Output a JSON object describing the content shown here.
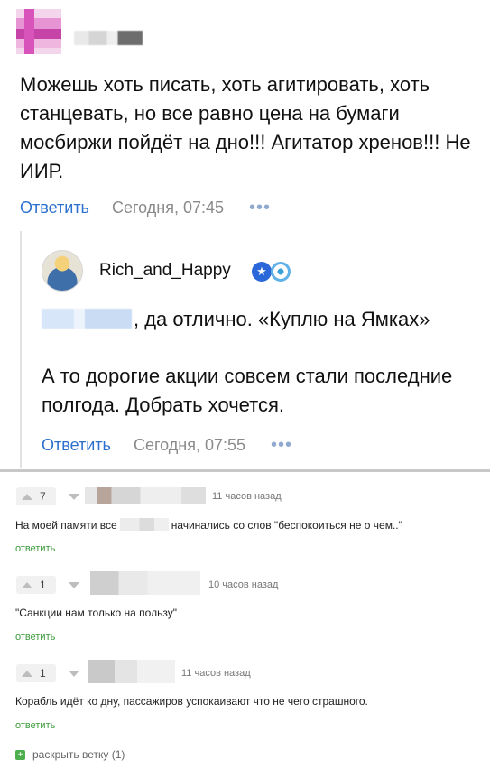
{
  "post": {
    "text": "Можешь хоть  писать, хоть агитировать, хоть станцевать, но все равно цена на бумаги мосбиржи пойдёт на дно!!! Агитатор хренов!!! Не ИИР.",
    "reply_label": "Ответить",
    "time": "Сегодня, 07:45",
    "more": "•••"
  },
  "reply": {
    "username": "Rich_and_Happy",
    "badge_star": "★",
    "line1": ", да отлично. «Куплю на Ямках»",
    "line2": "А то дорогие акции совсем стали последние полгода. Добрать хочется.",
    "reply_label": "Ответить",
    "time": "Сегодня, 07:55",
    "more": "•••"
  },
  "comments": [
    {
      "votes": "7",
      "time": "11 часов назад",
      "text_before": "На моей памяти все",
      "text_after": "начинались со слов \"беспокоиться не о чем..\"",
      "reply_label": "ответить"
    },
    {
      "votes": "1",
      "time": "10 часов назад",
      "text": "\"Санкции нам только на пользу\"",
      "reply_label": "ответить"
    },
    {
      "votes": "1",
      "time": "11 часов назад",
      "text": "Корабль идёт ко дну, пассажиров успокаивают что не чего страшного.",
      "reply_label": "ответить"
    }
  ],
  "expand_thread": {
    "icon": "+",
    "label": "раскрыть ветку (1)"
  },
  "colors": {
    "link_blue": "#2b6fcf",
    "reply_green": "#3a9a3a",
    "muted": "#8a8a8a"
  }
}
